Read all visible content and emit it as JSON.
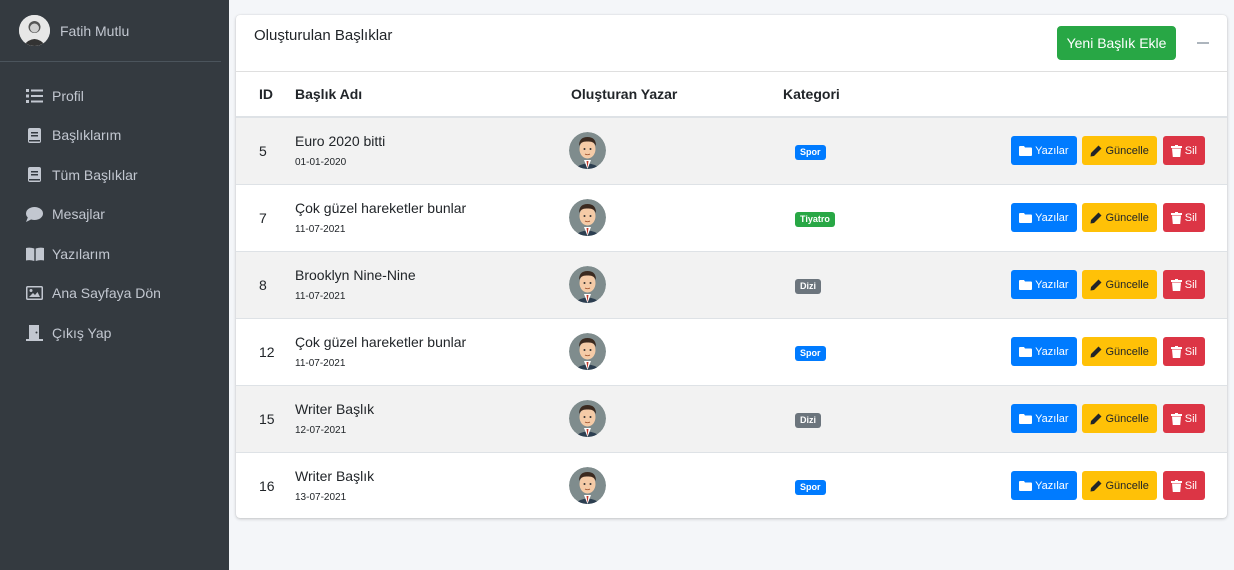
{
  "sidebar": {
    "user_name": "Fatih Mutlu",
    "items": [
      {
        "label": "Profil",
        "icon": "list-icon"
      },
      {
        "label": "Başlıklarım",
        "icon": "book-icon"
      },
      {
        "label": "Tüm Başlıklar",
        "icon": "book-icon"
      },
      {
        "label": "Mesajlar",
        "icon": "comment-icon"
      },
      {
        "label": "Yazılarım",
        "icon": "book-open-icon"
      },
      {
        "label": "Ana Sayfaya Dön",
        "icon": "image-icon"
      },
      {
        "label": "Çıkış Yap",
        "icon": "door-icon"
      }
    ]
  },
  "card": {
    "title": "Oluşturulan Başlıklar",
    "new_button": "Yeni Başlık Ekle"
  },
  "table": {
    "headers": {
      "id": "ID",
      "name": "Başlık Adı",
      "author": "Oluşturan Yazar",
      "category": "Kategori"
    },
    "actions": {
      "posts": "Yazılar",
      "update": "Güncelle",
      "delete": "Sil"
    },
    "rows": [
      {
        "id": "5",
        "title": "Euro 2020 bitti",
        "date": "01-01-2020",
        "category": "Spor",
        "category_color": "#007bff"
      },
      {
        "id": "7",
        "title": "Çok güzel hareketler bunlar",
        "date": "11-07-2021",
        "category": "Tiyatro",
        "category_color": "#28a745"
      },
      {
        "id": "8",
        "title": "Brooklyn Nine-Nine",
        "date": "11-07-2021",
        "category": "Dizi",
        "category_color": "#6c757d"
      },
      {
        "id": "12",
        "title": "Çok güzel hareketler bunlar",
        "date": "11-07-2021",
        "category": "Spor",
        "category_color": "#007bff"
      },
      {
        "id": "15",
        "title": "Writer Başlık",
        "date": "12-07-2021",
        "category": "Dizi",
        "category_color": "#6c757d"
      },
      {
        "id": "16",
        "title": "Writer Başlık",
        "date": "13-07-2021",
        "category": "Spor",
        "category_color": "#007bff"
      }
    ]
  },
  "colors": {
    "sidebar_bg": "#343a40",
    "primary": "#007bff",
    "success": "#28a745",
    "warning": "#ffc107",
    "danger": "#dc3545",
    "secondary": "#6c757d"
  }
}
